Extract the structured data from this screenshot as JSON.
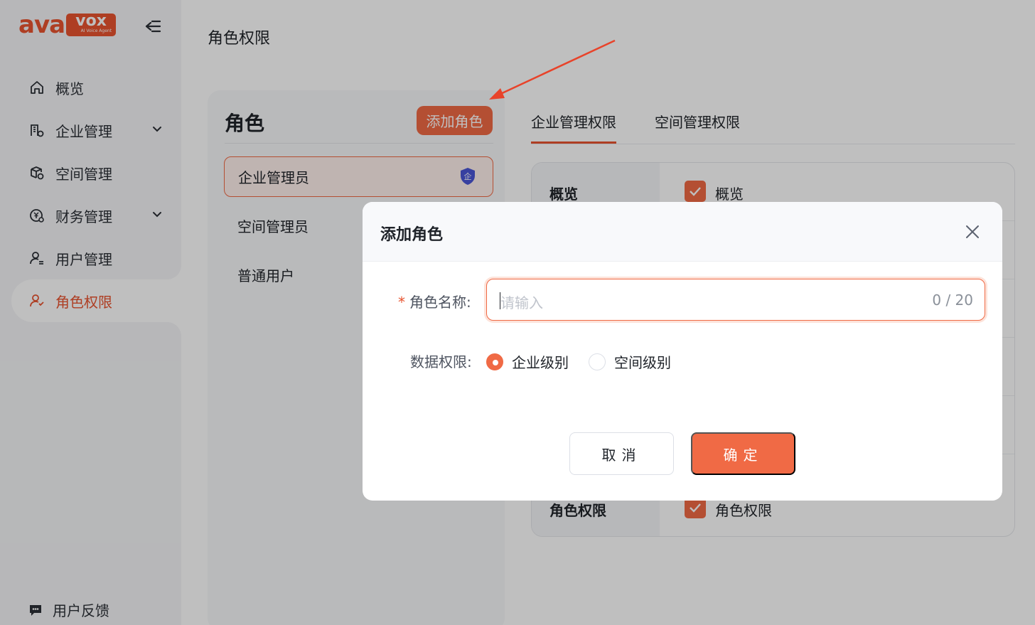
{
  "brand": {
    "logo_main": "ava",
    "logo_box": "vox",
    "logo_tagline": "AI Voice Agent",
    "accent": "#e8532f"
  },
  "sidebar": {
    "items": [
      {
        "label": "概览",
        "icon": "home-icon",
        "active": false,
        "expandable": false
      },
      {
        "label": "企业管理",
        "icon": "enterprise-icon",
        "active": false,
        "expandable": true
      },
      {
        "label": "空间管理",
        "icon": "space-icon",
        "active": false,
        "expandable": false
      },
      {
        "label": "财务管理",
        "icon": "finance-icon",
        "active": false,
        "expandable": true
      },
      {
        "label": "用户管理",
        "icon": "user-icon",
        "active": false,
        "expandable": false
      },
      {
        "label": "角色权限",
        "icon": "role-icon",
        "active": true,
        "expandable": false
      }
    ],
    "feedback_label": "用户反馈"
  },
  "page": {
    "title": "角色权限"
  },
  "roles": {
    "title": "角色",
    "add_button": "添加角色",
    "items": [
      {
        "label": "企业管理员",
        "selected": true,
        "badge": "企"
      },
      {
        "label": "空间管理员",
        "selected": false
      },
      {
        "label": "普通用户",
        "selected": false
      }
    ]
  },
  "permissions": {
    "tabs": [
      {
        "label": "企业管理权限",
        "active": true
      },
      {
        "label": "空间管理权限",
        "active": false
      }
    ],
    "rows": [
      {
        "name": "概览",
        "checked_label": "概览"
      },
      {
        "name": "",
        "checked_label": ""
      },
      {
        "name": "",
        "checked_label": ""
      },
      {
        "name": "",
        "checked_label": ""
      },
      {
        "name": "",
        "checked_label": ""
      },
      {
        "name": "角色权限",
        "checked_label": "角色权限"
      }
    ]
  },
  "modal": {
    "title": "添加角色",
    "name_label": "角色名称:",
    "name_required": "*",
    "name_placeholder": "请输入",
    "name_value": "",
    "name_count": "0 / 20",
    "scope_label": "数据权限:",
    "scope_options": [
      {
        "label": "企业级别",
        "checked": true
      },
      {
        "label": "空间级别",
        "checked": false
      }
    ],
    "cancel_label": "取消",
    "confirm_label": "确定"
  }
}
